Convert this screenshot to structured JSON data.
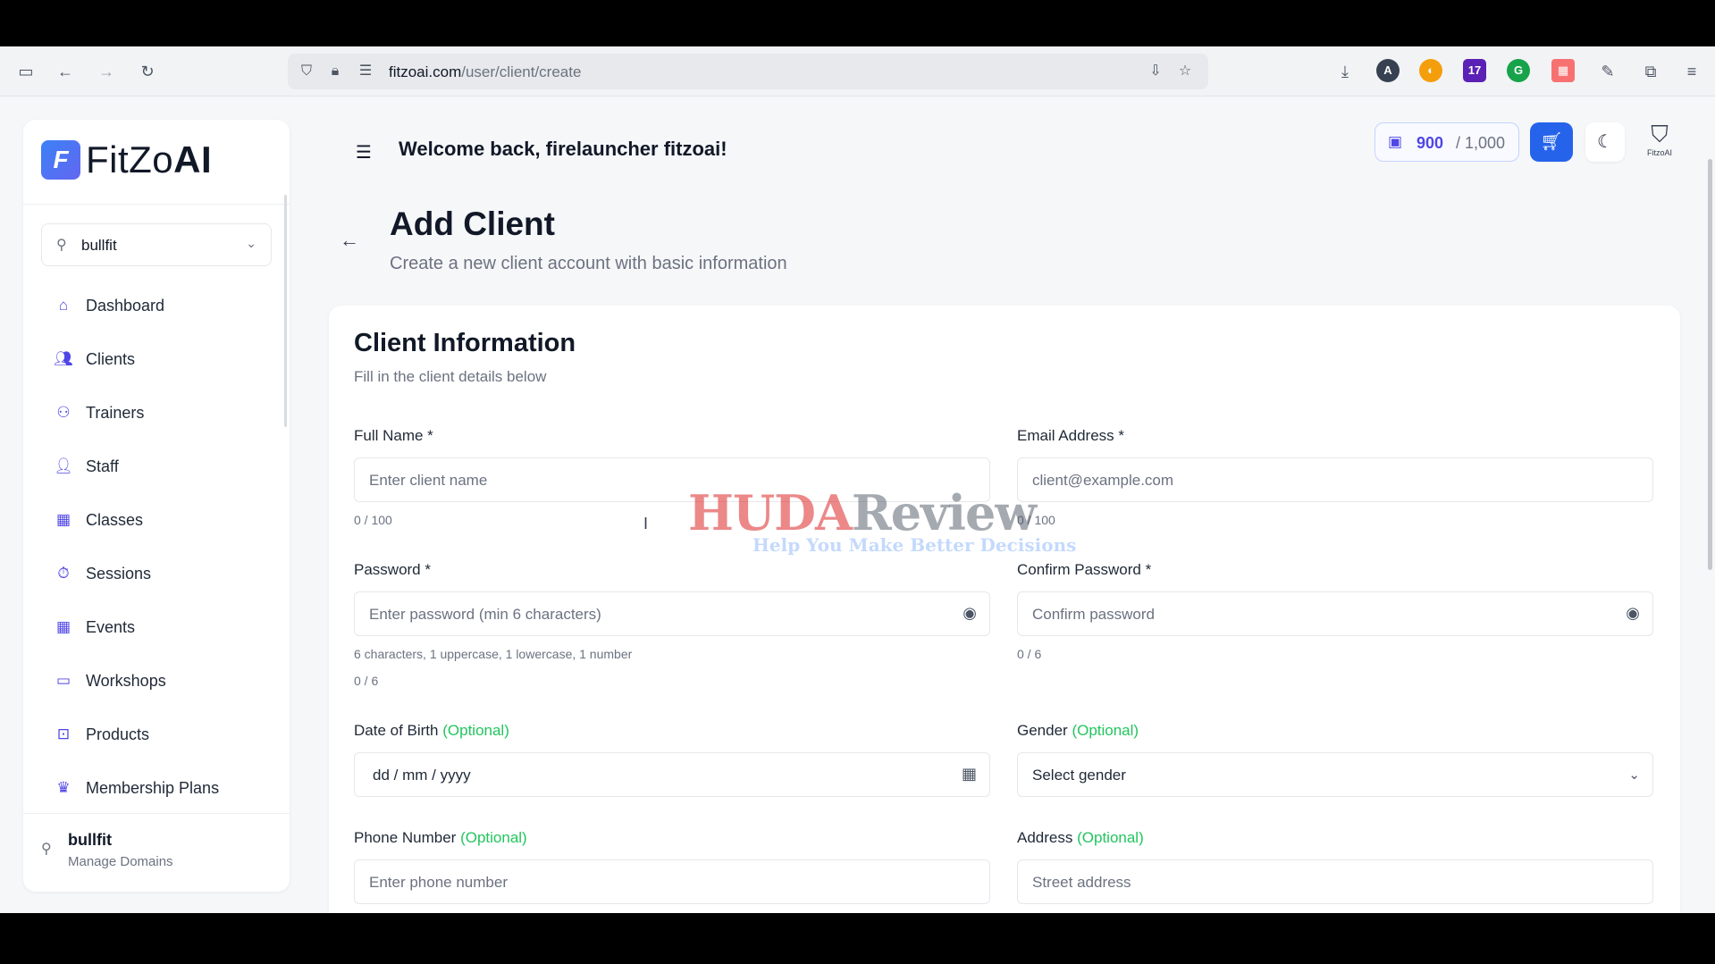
{
  "browser": {
    "url_domain": "fitzoai.com",
    "url_path": "/user/client/create"
  },
  "sidebar": {
    "logo_prefix": "FitZo",
    "logo_suffix": "AI",
    "logo_mark": "F",
    "domain_selector": "bullfit",
    "items": [
      {
        "label": "Dashboard",
        "icon": "home-icon"
      },
      {
        "label": "Clients",
        "icon": "users-icon"
      },
      {
        "label": "Trainers",
        "icon": "trainer-icon"
      },
      {
        "label": "Staff",
        "icon": "staff-icon"
      },
      {
        "label": "Classes",
        "icon": "calendar-icon"
      },
      {
        "label": "Sessions",
        "icon": "timer-icon"
      },
      {
        "label": "Events",
        "icon": "calendar-icon"
      },
      {
        "label": "Workshops",
        "icon": "monitor-icon"
      },
      {
        "label": "Products",
        "icon": "bag-icon"
      },
      {
        "label": "Membership Plans",
        "icon": "crown-icon"
      }
    ],
    "footer_name": "bullfit",
    "footer_sub": "Manage Domains"
  },
  "header": {
    "welcome": "Welcome back, firelauncher fitzoai!",
    "credits_used": "900",
    "credits_total": "/ 1,000",
    "avatar_text": "FitzoAI"
  },
  "page": {
    "title": "Add Client",
    "subtitle": "Create a new client account with basic information"
  },
  "form": {
    "title": "Client Information",
    "subtitle": "Fill in the client details below",
    "full_name": {
      "label": "Full Name *",
      "placeholder": "Enter client name",
      "counter": "0 / 100"
    },
    "email": {
      "label": "Email Address *",
      "placeholder": "client@example.com",
      "counter": "0 / 100"
    },
    "password": {
      "label": "Password *",
      "placeholder": "Enter password (min 6 characters)",
      "hint": "6 characters, 1 uppercase, 1 lowercase, 1 number",
      "counter": "0 / 6"
    },
    "confirm_password": {
      "label": "Confirm Password *",
      "placeholder": "Confirm password",
      "counter": "0 / 6"
    },
    "dob": {
      "label": "Date of Birth",
      "optional": "(Optional)",
      "value": "dd / mm / yyyy"
    },
    "gender": {
      "label": "Gender",
      "optional": "(Optional)",
      "value": "Select gender"
    },
    "phone": {
      "label": "Phone Number",
      "optional": "(Optional)",
      "placeholder": "Enter phone number"
    },
    "address": {
      "label": "Address",
      "optional": "(Optional)",
      "placeholder": "Street address"
    }
  },
  "watermark": {
    "brand_red": "HUDA",
    "brand_gray": "Review",
    "tagline": "Help You Make Better Decisions"
  },
  "colors": {
    "accent": "#2563eb",
    "icon": "#4f46e5",
    "optional": "#22c55e"
  }
}
